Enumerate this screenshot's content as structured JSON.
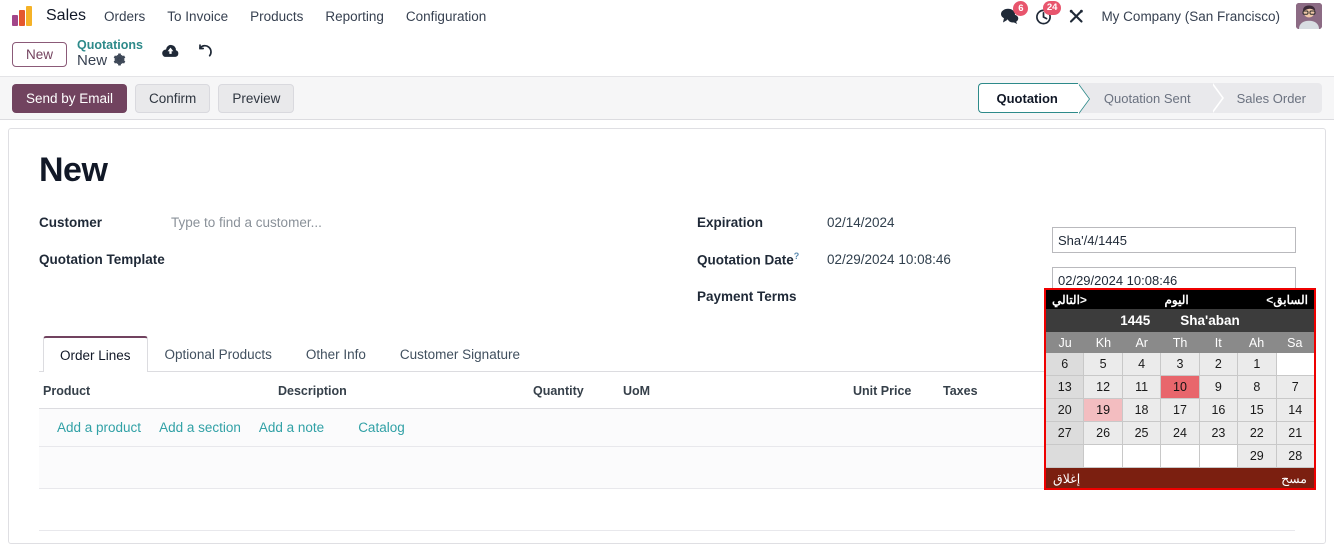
{
  "navbar": {
    "brand": "Sales",
    "logo_icon": "odoo-bars-logo",
    "menu": [
      {
        "label": "Orders"
      },
      {
        "label": "To Invoice"
      },
      {
        "label": "Products"
      },
      {
        "label": "Reporting"
      },
      {
        "label": "Configuration"
      }
    ],
    "messages_icon": "chat-bubbles-icon",
    "messages_count": "6",
    "activities_icon": "clock-icon",
    "activities_count": "24",
    "tools_icon": "wrench-screwdriver-icon",
    "company": "My Company (San Francisco)",
    "avatar_icon": "user-avatar"
  },
  "breadcrumb": {
    "new_button": "New",
    "parent": "Quotations",
    "current": "New",
    "gear_icon": "gear-icon",
    "save_icon": "cloud-upload-icon",
    "discard_icon": "undo-icon"
  },
  "actionbar": {
    "send_by_email": "Send by Email",
    "confirm": "Confirm",
    "preview": "Preview",
    "stages": [
      {
        "label": "Quotation",
        "active": true
      },
      {
        "label": "Quotation Sent",
        "active": false
      },
      {
        "label": "Sales Order",
        "active": false
      }
    ]
  },
  "form": {
    "title": "New",
    "customer_label": "Customer",
    "customer_placeholder": "Type to find a customer...",
    "quotation_template_label": "Quotation Template",
    "quotation_template_value": "",
    "expiration_label": "Expiration",
    "expiration_value": "02/14/2024",
    "quotation_date_label": "Quotation Date",
    "quotation_date_help": "?",
    "quotation_date_value": "02/29/2024 10:08:46",
    "payment_terms_label": "Payment Terms",
    "payment_terms_value": "",
    "hijri_input_value": "Sha'/4/1445",
    "gregorian_input_value": "02/29/2024 10:08:46"
  },
  "notebook": {
    "tabs": [
      {
        "label": "Order Lines",
        "active": true
      },
      {
        "label": "Optional Products",
        "active": false
      },
      {
        "label": "Other Info",
        "active": false
      },
      {
        "label": "Customer Signature",
        "active": false
      }
    ],
    "columns": {
      "product": "Product",
      "description": "Description",
      "quantity": "Quantity",
      "uom": "UoM",
      "unit_price": "Unit Price",
      "taxes": "Taxes",
      "optional_columns_icon": "sliders-toggle-icon"
    },
    "add_links": [
      {
        "label": "Add a product"
      },
      {
        "label": "Add a section"
      },
      {
        "label": "Add a note"
      },
      {
        "label": "Catalog"
      }
    ]
  },
  "datepicker": {
    "nav": {
      "prev": "السابق>",
      "today": "اليوم",
      "next": "<التالي"
    },
    "year": "1445",
    "month": "Sha'aban",
    "weekdays": [
      "Ju",
      "Kh",
      "Ar",
      "Th",
      "It",
      "Ah",
      "Sa"
    ],
    "weeks": [
      [
        {
          "day": "6"
        },
        {
          "day": "5"
        },
        {
          "day": "4"
        },
        {
          "day": "3"
        },
        {
          "day": "2"
        },
        {
          "day": "1"
        },
        {
          "day": ""
        }
      ],
      [
        {
          "day": "13"
        },
        {
          "day": "12"
        },
        {
          "day": "11"
        },
        {
          "day": "10",
          "state": "selected"
        },
        {
          "day": "9"
        },
        {
          "day": "8"
        },
        {
          "day": "7"
        }
      ],
      [
        {
          "day": "20"
        },
        {
          "day": "19",
          "state": "today"
        },
        {
          "day": "18"
        },
        {
          "day": "17"
        },
        {
          "day": "16"
        },
        {
          "day": "15"
        },
        {
          "day": "14"
        }
      ],
      [
        {
          "day": "27"
        },
        {
          "day": "26"
        },
        {
          "day": "25"
        },
        {
          "day": "24"
        },
        {
          "day": "23"
        },
        {
          "day": "22"
        },
        {
          "day": "21"
        }
      ],
      [
        {
          "day": ""
        },
        {
          "day": ""
        },
        {
          "day": ""
        },
        {
          "day": ""
        },
        {
          "day": ""
        },
        {
          "day": "29"
        },
        {
          "day": "28"
        }
      ]
    ],
    "footer": {
      "close": "إغلاق",
      "clear": "مسح"
    },
    "colors": {
      "border": "#ee0000",
      "nav_bg": "#000000",
      "month_bg": "#3c3c3c",
      "weekday_bg": "#8a8a8a",
      "selected_bg": "#e8666c",
      "today_bg": "#f3bdc0",
      "footer_bg": "#7b1f10"
    }
  }
}
